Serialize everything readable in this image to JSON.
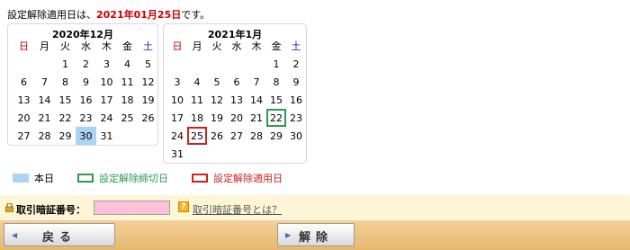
{
  "notice": {
    "prefix": "設定解除適用日は、",
    "date": "2021年01月25日",
    "suffix": "です。"
  },
  "weekdays": [
    "日",
    "月",
    "火",
    "水",
    "木",
    "金",
    "土"
  ],
  "calendars": [
    {
      "title": "2020年12月",
      "weeks": [
        [
          "",
          "",
          "1",
          "2",
          "3",
          "4",
          "5"
        ],
        [
          "6",
          "7",
          "8",
          "9",
          "10",
          "11",
          "12"
        ],
        [
          "13",
          "14",
          "15",
          "16",
          "17",
          "18",
          "19"
        ],
        [
          "20",
          "21",
          "22",
          "23",
          "24",
          "25",
          "26"
        ],
        [
          "27",
          "28",
          "29",
          "30",
          "31",
          "",
          ""
        ]
      ],
      "today": "30"
    },
    {
      "title": "2021年1月",
      "weeks": [
        [
          "",
          "",
          "",
          "",
          "",
          "1",
          "2"
        ],
        [
          "3",
          "4",
          "5",
          "6",
          "7",
          "8",
          "9"
        ],
        [
          "10",
          "11",
          "12",
          "13",
          "14",
          "15",
          "16"
        ],
        [
          "17",
          "18",
          "19",
          "20",
          "21",
          "22",
          "23"
        ],
        [
          "24",
          "25",
          "26",
          "27",
          "28",
          "29",
          "30"
        ],
        [
          "31",
          "",
          "",
          "",
          "",
          "",
          ""
        ]
      ],
      "deadline": "22",
      "apply": "25"
    }
  ],
  "legend": {
    "today": "本日",
    "deadline": "設定解除締切日",
    "apply": "設定解除適用日"
  },
  "auth": {
    "label": "取引暗証番号：",
    "value": "",
    "help_link": "取引暗証番号とは？"
  },
  "buttons": {
    "back": "戻る",
    "cancel": "解除"
  },
  "colors": {
    "sunday": "#cc0000",
    "saturday": "#1a1aa8",
    "today": "#a9d4f5",
    "deadline": "#2e9a4f",
    "apply": "#cc2222",
    "button_bar": "#e7b86e",
    "auth_bar": "#fdf6d6",
    "input": "#ffc0da"
  },
  "icons": {
    "lock": "lock-icon",
    "help": "help-icon",
    "arrow": "arrow-left-icon"
  }
}
